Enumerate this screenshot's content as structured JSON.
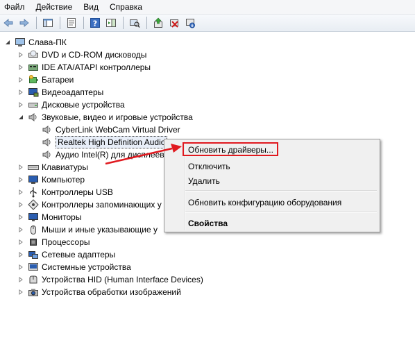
{
  "menu": [
    "Файл",
    "Действие",
    "Вид",
    "Справка"
  ],
  "toolbar_icons": [
    "back-icon",
    "forward-icon",
    "show-hide-tree-icon",
    "properties-icon",
    "help-icon",
    "action-pane-icon",
    "scan-hardware-icon",
    "update-driver-icon",
    "disable-device-icon",
    "uninstall-device-icon"
  ],
  "tree": {
    "root": "Слава-ПК",
    "items": [
      {
        "label": "DVD и CD-ROM дисководы",
        "icon": "dvd-drive-icon"
      },
      {
        "label": "IDE ATA/ATAPI контроллеры",
        "icon": "ide-controller-icon"
      },
      {
        "label": "Батареи",
        "icon": "battery-icon"
      },
      {
        "label": "Видеоадаптеры",
        "icon": "display-adapter-icon"
      },
      {
        "label": "Дисковые устройства",
        "icon": "disk-drive-icon"
      },
      {
        "label": "Звуковые, видео и игровые устройства",
        "icon": "sound-icon"
      },
      {
        "label": "CyberLink WebCam Virtual Driver",
        "icon": "speaker-icon"
      },
      {
        "label": "Realtek High Definition Audio",
        "icon": "speaker-icon"
      },
      {
        "label": "Аудио Intel(R) для дисплеев",
        "icon": "speaker-icon"
      },
      {
        "label": "Клавиатуры",
        "icon": "keyboard-icon"
      },
      {
        "label": "Компьютер",
        "icon": "computer-icon"
      },
      {
        "label": "Контроллеры USB",
        "icon": "usb-icon"
      },
      {
        "label": "Контроллеры запоминающих у",
        "icon": "storage-controller-icon"
      },
      {
        "label": "Мониторы",
        "icon": "monitor-icon"
      },
      {
        "label": "Мыши и иные указывающие у",
        "icon": "mouse-icon"
      },
      {
        "label": "Процессоры",
        "icon": "processor-icon"
      },
      {
        "label": "Сетевые адаптеры",
        "icon": "network-adapter-icon"
      },
      {
        "label": "Системные устройства",
        "icon": "system-devices-icon"
      },
      {
        "label": "Устройства HID (Human Interface Devices)",
        "icon": "hid-icon"
      },
      {
        "label": "Устройства обработки изображений",
        "icon": "imaging-device-icon"
      }
    ]
  },
  "context_menu": {
    "items": [
      "Обновить драйверы...",
      "Отключить",
      "Удалить",
      "Обновить конфигурацию оборудования",
      "Свойства"
    ]
  },
  "colors": {
    "highlight_box": "#e0191f",
    "arrow": "#e0191f"
  }
}
